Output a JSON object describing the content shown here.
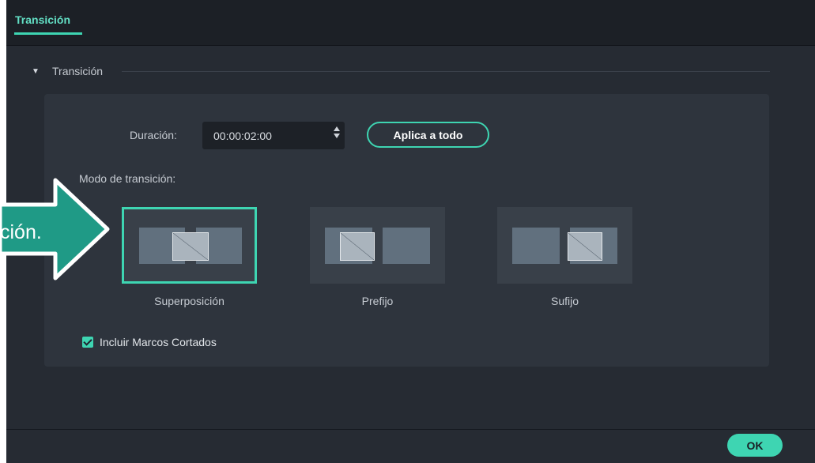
{
  "tabs": [
    {
      "label": "Transición",
      "active": true
    }
  ],
  "section": {
    "title": "Transición",
    "expanded": true
  },
  "duration": {
    "label": "Duración:",
    "value": "00:00:02:00"
  },
  "apply_all_label": "Aplica a todo",
  "mode": {
    "label": "Modo de transición:",
    "options": [
      {
        "name": "Superposición",
        "selected": true
      },
      {
        "name": "Prefijo",
        "selected": false
      },
      {
        "name": "Sufijo",
        "selected": false
      }
    ]
  },
  "include_trimmed": {
    "label": "Incluir Marcos Cortados",
    "checked": true
  },
  "ok_label": "OK",
  "callout": {
    "text": "ción."
  },
  "colors": {
    "accent": "#3ed5b2",
    "panel": "#2e343d",
    "background": "#262b33",
    "callout": "#1f9a86"
  }
}
